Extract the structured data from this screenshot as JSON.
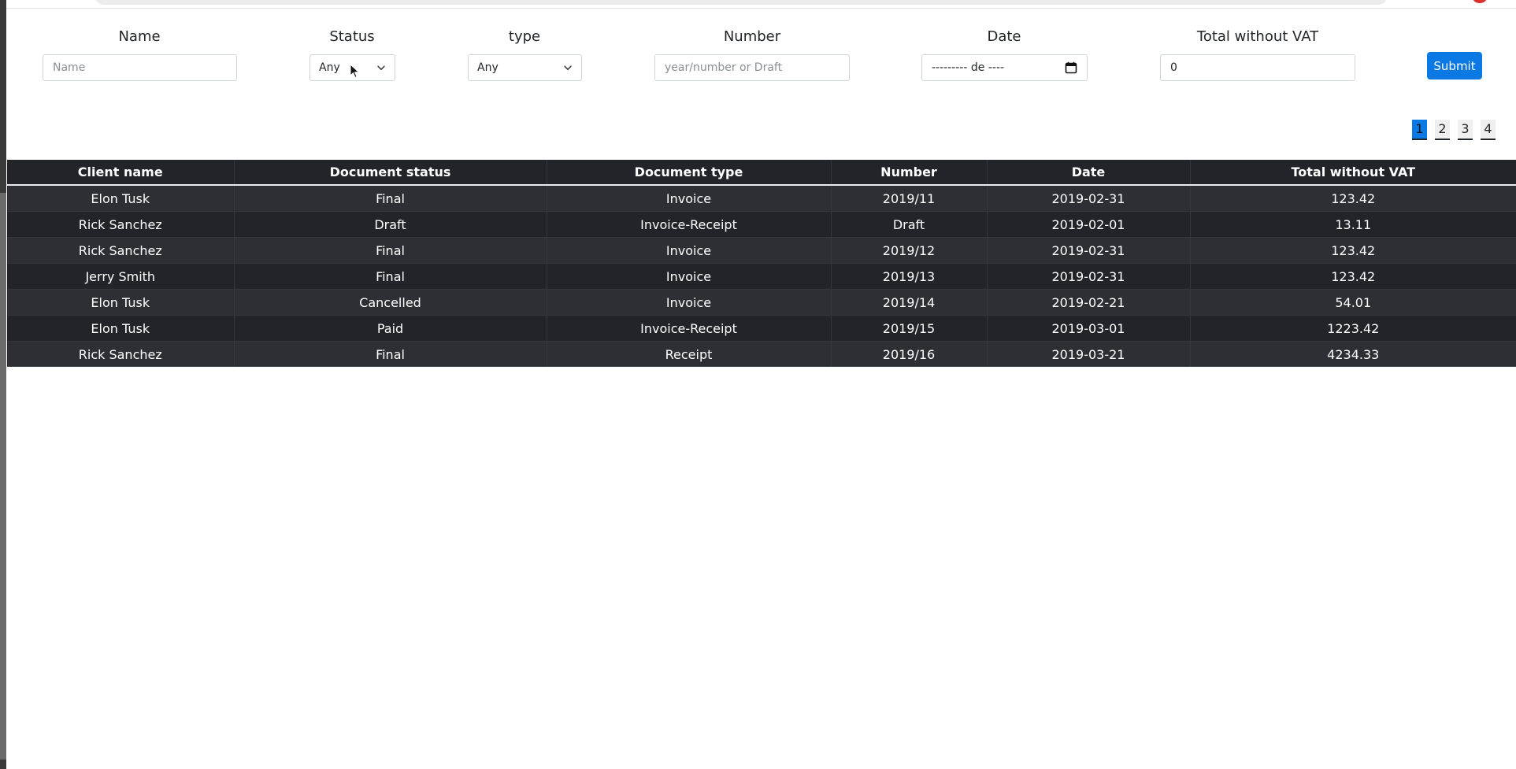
{
  "filters": {
    "name": {
      "label": "Name",
      "placeholder": "Name",
      "value": ""
    },
    "status": {
      "label": "Status",
      "selected": "Any"
    },
    "type": {
      "label": "type",
      "selected": "Any"
    },
    "number": {
      "label": "Number",
      "placeholder": "year/number or Draft",
      "value": ""
    },
    "date": {
      "label": "Date",
      "display": "--------- de ----"
    },
    "total": {
      "label": "Total without VAT",
      "value": "0"
    },
    "submit_label": "Submit"
  },
  "pagination": {
    "pages": [
      "1",
      "2",
      "3",
      "4"
    ],
    "current": "1"
  },
  "table": {
    "headers": [
      "Client name",
      "Document status",
      "Document type",
      "Number",
      "Date",
      "Total without VAT"
    ],
    "rows": [
      [
        "Elon Tusk",
        "Final",
        "Invoice",
        "2019/11",
        "2019-02-31",
        "123.42"
      ],
      [
        "Rick Sanchez",
        "Draft",
        "Invoice-Receipt",
        "Draft",
        "2019-02-01",
        "13.11"
      ],
      [
        "Rick Sanchez",
        "Final",
        "Invoice",
        "2019/12",
        "2019-02-31",
        "123.42"
      ],
      [
        "Jerry Smith",
        "Final",
        "Invoice",
        "2019/13",
        "2019-02-31",
        "123.42"
      ],
      [
        "Elon Tusk",
        "Cancelled",
        "Invoice",
        "2019/14",
        "2019-02-21",
        "54.01"
      ],
      [
        "Elon Tusk",
        "Paid",
        "Invoice-Receipt",
        "2019/15",
        "2019-03-01",
        "1223.42"
      ],
      [
        "Rick Sanchez",
        "Final",
        "Receipt",
        "2019/16",
        "2019-03-21",
        "4234.33"
      ]
    ]
  },
  "colors": {
    "accent": "#0b79e3",
    "table_dark": "#212529",
    "table_stripe": "#2c3034",
    "notification": "#d9302c"
  }
}
